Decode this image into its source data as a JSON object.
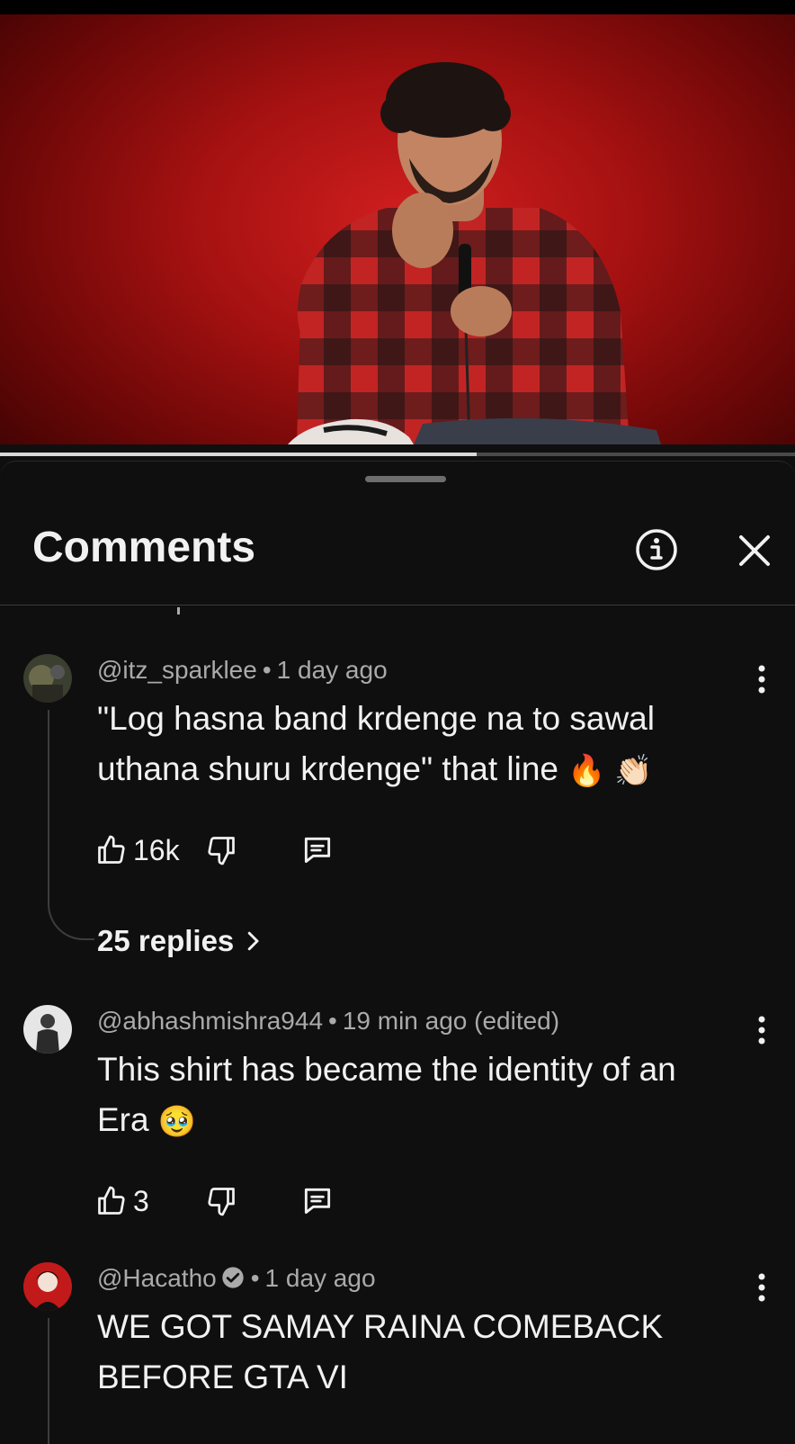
{
  "video": {
    "progress_fraction": 0.6
  },
  "comments_panel": {
    "title": "Comments",
    "info_icon": "info-icon",
    "close_icon": "close-icon",
    "comments": [
      {
        "handle": "@itz_sparklee",
        "separator": "•",
        "time": "1 day ago",
        "text_line1": "\"Log hasna band krdenge na to sawal",
        "text_line2": "uthana shuru krdenge\" that line",
        "emoji": "🔥 👏🏻",
        "likes": "16k",
        "replies": "25 replies"
      },
      {
        "handle": "@abhashmishra944",
        "separator": "•",
        "time": "19 min ago (edited)",
        "text_line1": "This shirt has became the identity of an",
        "text_line2": "Era",
        "emoji": "🥹",
        "likes": "3"
      },
      {
        "handle": "@Hacatho",
        "verified": true,
        "separator": "•",
        "time": "1 day ago",
        "text_line1": "WE GOT SAMAY RAINA COMEBACK",
        "text_line2": "BEFORE GTA VI"
      }
    ]
  },
  "colors": {
    "background": "#0f0f0f",
    "text_primary": "#f1f1f1",
    "text_secondary": "#aaaaaa",
    "video_red": "#c81a1a"
  }
}
